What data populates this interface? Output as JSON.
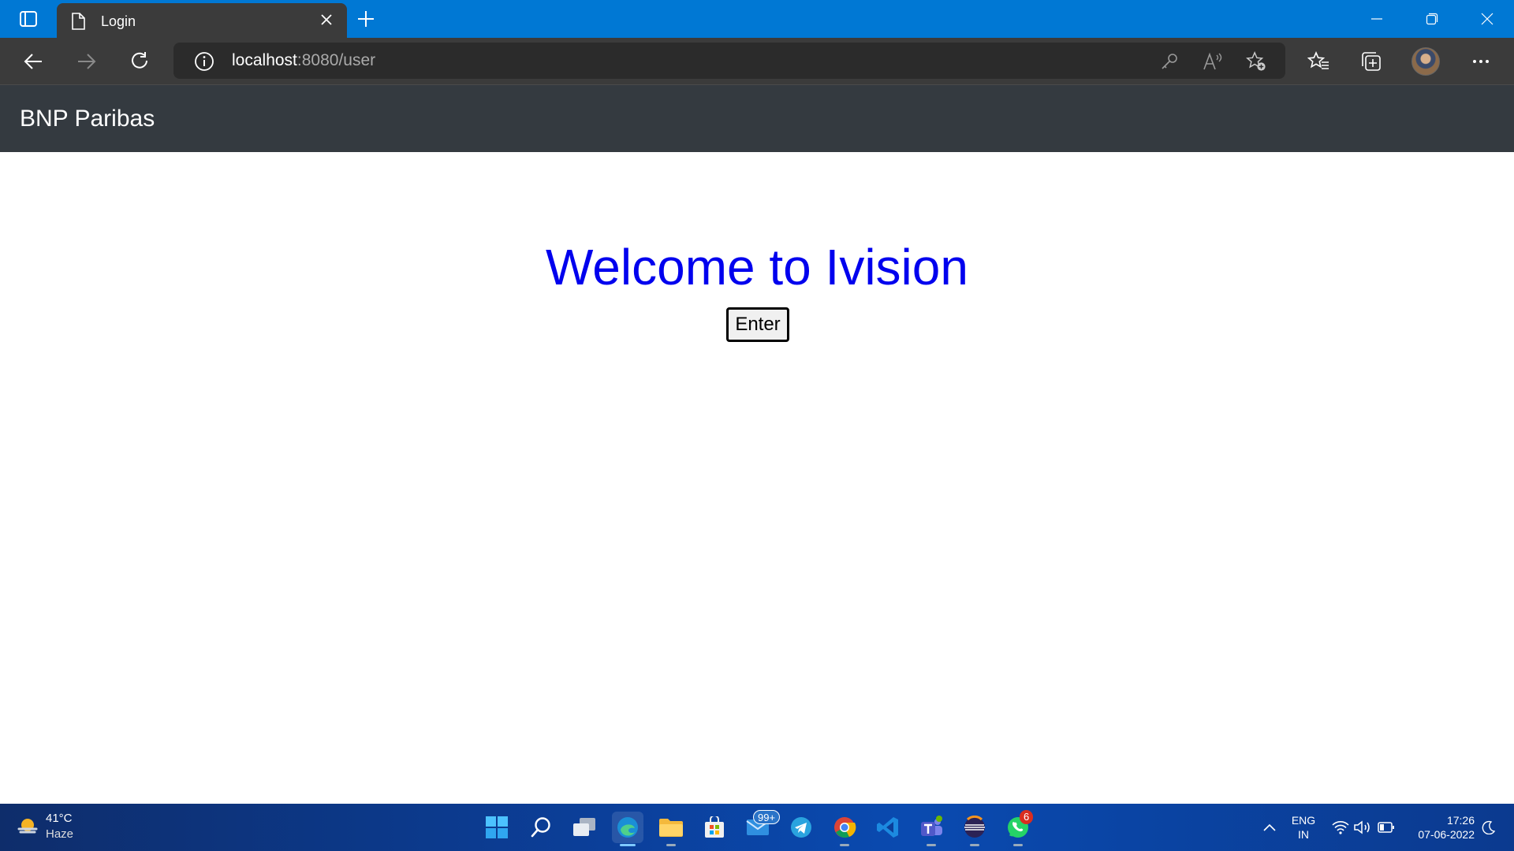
{
  "browser": {
    "tab_title": "Login",
    "url_host": "localhost",
    "url_path": ":8080/user"
  },
  "app": {
    "brand": "BNP Paribas",
    "welcome_heading": "Welcome to Ivision",
    "enter_button": "Enter"
  },
  "taskbar": {
    "weather_temp": "41°C",
    "weather_condition": "Haze",
    "mail_badge": "99+",
    "whatsapp_badge": "6",
    "lang_line1": "ENG",
    "lang_line2": "IN",
    "time": "17:26",
    "date": "07-06-2022"
  },
  "colors": {
    "titlebar": "#0078d4",
    "toolbar": "#3b3b3b",
    "navbar": "#343a40",
    "heading": "#0000ee"
  }
}
